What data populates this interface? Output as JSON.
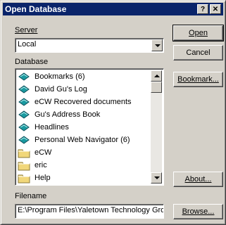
{
  "window": {
    "title": "Open Database",
    "help_button": "?",
    "close_button": "✕"
  },
  "server": {
    "label": "Server",
    "value": "Local"
  },
  "database": {
    "label": "Database",
    "items": [
      {
        "label": "Bookmarks (6)",
        "icon": "database-icon"
      },
      {
        "label": "David Gu's Log",
        "icon": "database-icon"
      },
      {
        "label": "eCW Recovered documents",
        "icon": "database-icon"
      },
      {
        "label": "Gu's Address Book",
        "icon": "database-icon"
      },
      {
        "label": "Headlines",
        "icon": "database-icon"
      },
      {
        "label": "Personal Web Navigator (6)",
        "icon": "database-icon"
      },
      {
        "label": "eCW",
        "icon": "folder-icon"
      },
      {
        "label": "eric",
        "icon": "folder-icon"
      },
      {
        "label": "Help",
        "icon": "folder-icon"
      }
    ]
  },
  "filename": {
    "label": "Filename",
    "value": "E:\\Program Files\\Yaletown Technology Gro"
  },
  "buttons": {
    "open": "Open",
    "cancel": "Cancel",
    "bookmark": "Bookmark...",
    "about": "About...",
    "browse": "Browse..."
  },
  "colors": {
    "titlebar": "#0a246a",
    "face": "#d4d0c8",
    "db_icon": "#1a9aa0",
    "folder_icon": "#f1d77a"
  }
}
